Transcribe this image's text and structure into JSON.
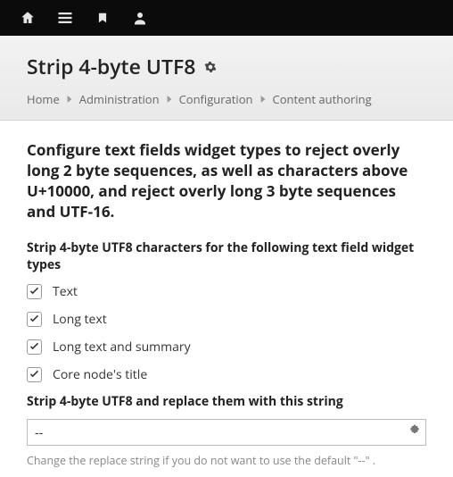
{
  "page": {
    "title": "Strip 4-byte UTF8"
  },
  "breadcrumb": {
    "items": [
      "Home",
      "Administration",
      "Configuration",
      "Content authoring"
    ]
  },
  "intro": "Configure text fields widget types to reject overly long 2 byte sequences, as well as characters above U+10000, and reject overly long 3 byte sequences and UTF-16.",
  "section1": {
    "label": "Strip 4-byte UTF8 characters for the following text field widget types",
    "options": [
      {
        "label": "Text",
        "checked": true
      },
      {
        "label": "Long text",
        "checked": true
      },
      {
        "label": "Long text and summary",
        "checked": true
      },
      {
        "label": "Core node's title",
        "checked": true
      }
    ]
  },
  "section2": {
    "label": "Strip 4-byte UTF8 and replace them with this string",
    "value": "--",
    "help": "Change the replace string if you do not want to use the default \"--\" ."
  }
}
